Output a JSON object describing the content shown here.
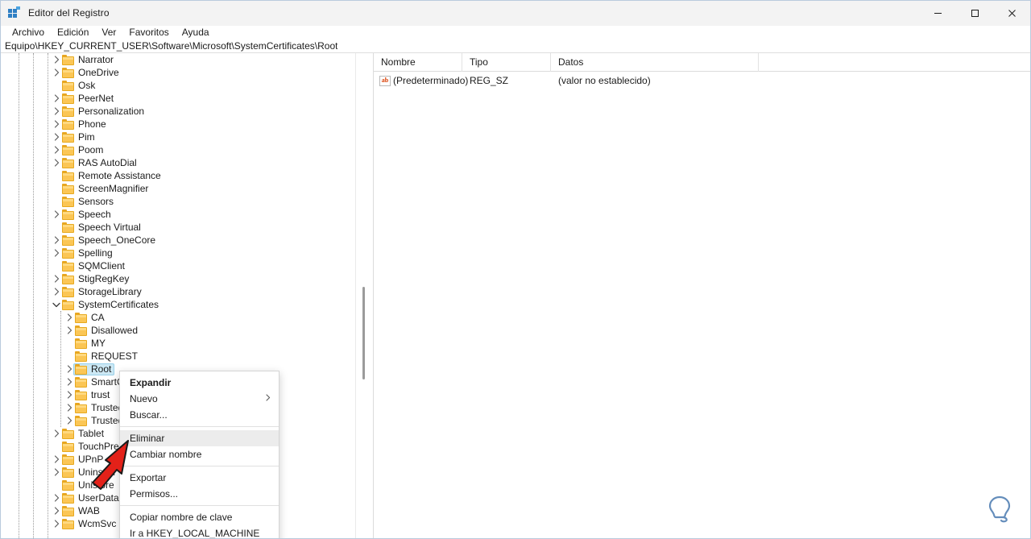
{
  "window": {
    "title": "Editor del Registro",
    "icon": "registry-editor-icon",
    "controls": {
      "minimize": "minimize-icon",
      "maximize": "maximize-icon",
      "close": "close-icon"
    }
  },
  "menubar": {
    "items": [
      {
        "label": "Archivo"
      },
      {
        "label": "Edición"
      },
      {
        "label": "Ver"
      },
      {
        "label": "Favoritos"
      },
      {
        "label": "Ayuda"
      }
    ]
  },
  "addressbar": {
    "path": "Equipo\\HKEY_CURRENT_USER\\Software\\Microsoft\\SystemCertificates\\Root"
  },
  "tree": {
    "nodes": [
      {
        "label": "Narrator",
        "depth": 1,
        "arrow": "collapsed"
      },
      {
        "label": "OneDrive",
        "depth": 1,
        "arrow": "collapsed"
      },
      {
        "label": "Osk",
        "depth": 1,
        "arrow": "none"
      },
      {
        "label": "PeerNet",
        "depth": 1,
        "arrow": "collapsed"
      },
      {
        "label": "Personalization",
        "depth": 1,
        "arrow": "collapsed"
      },
      {
        "label": "Phone",
        "depth": 1,
        "arrow": "collapsed"
      },
      {
        "label": "Pim",
        "depth": 1,
        "arrow": "collapsed"
      },
      {
        "label": "Poom",
        "depth": 1,
        "arrow": "collapsed"
      },
      {
        "label": "RAS AutoDial",
        "depth": 1,
        "arrow": "collapsed"
      },
      {
        "label": "Remote Assistance",
        "depth": 1,
        "arrow": "none"
      },
      {
        "label": "ScreenMagnifier",
        "depth": 1,
        "arrow": "none"
      },
      {
        "label": "Sensors",
        "depth": 1,
        "arrow": "none"
      },
      {
        "label": "Speech",
        "depth": 1,
        "arrow": "collapsed"
      },
      {
        "label": "Speech Virtual",
        "depth": 1,
        "arrow": "none"
      },
      {
        "label": "Speech_OneCore",
        "depth": 1,
        "arrow": "collapsed"
      },
      {
        "label": "Spelling",
        "depth": 1,
        "arrow": "collapsed"
      },
      {
        "label": "SQMClient",
        "depth": 1,
        "arrow": "none"
      },
      {
        "label": "StigRegKey",
        "depth": 1,
        "arrow": "collapsed"
      },
      {
        "label": "StorageLibrary",
        "depth": 1,
        "arrow": "collapsed"
      },
      {
        "label": "SystemCertificates",
        "depth": 1,
        "arrow": "expanded"
      },
      {
        "label": "CA",
        "depth": 2,
        "arrow": "collapsed"
      },
      {
        "label": "Disallowed",
        "depth": 2,
        "arrow": "collapsed"
      },
      {
        "label": "MY",
        "depth": 2,
        "arrow": "none"
      },
      {
        "label": "REQUEST",
        "depth": 2,
        "arrow": "none"
      },
      {
        "label": "Root",
        "depth": 2,
        "arrow": "collapsed",
        "selected": true
      },
      {
        "label": "SmartCardRoot",
        "depth": 2,
        "arrow": "collapsed"
      },
      {
        "label": "trust",
        "depth": 2,
        "arrow": "collapsed"
      },
      {
        "label": "TrustedPeople",
        "depth": 2,
        "arrow": "collapsed"
      },
      {
        "label": "TrustedPublisher",
        "depth": 2,
        "arrow": "collapsed"
      },
      {
        "label": "Tablet",
        "depth": 1,
        "arrow": "collapsed"
      },
      {
        "label": "TouchPrediction",
        "depth": 1,
        "arrow": "none"
      },
      {
        "label": "UPnP",
        "depth": 1,
        "arrow": "collapsed"
      },
      {
        "label": "Uninstall",
        "depth": 1,
        "arrow": "collapsed"
      },
      {
        "label": "Unistore",
        "depth": 1,
        "arrow": "none"
      },
      {
        "label": "UserData",
        "depth": 1,
        "arrow": "collapsed"
      },
      {
        "label": "WAB",
        "depth": 1,
        "arrow": "collapsed"
      },
      {
        "label": "WcmSvc",
        "depth": 1,
        "arrow": "collapsed"
      }
    ]
  },
  "listview": {
    "columns": [
      "Nombre",
      "Tipo",
      "Datos"
    ],
    "rows": [
      {
        "icon": "string-value-icon",
        "name": "(Predeterminado)",
        "type": "REG_SZ",
        "data": "(valor no establecido)"
      }
    ]
  },
  "contextmenu": {
    "items": [
      {
        "label": "Expandir",
        "bold": true
      },
      {
        "label": "Nuevo",
        "submenu": true
      },
      {
        "label": "Buscar..."
      },
      {
        "separator": true
      },
      {
        "label": "Eliminar",
        "highlighted": true
      },
      {
        "label": "Cambiar nombre"
      },
      {
        "separator": true
      },
      {
        "label": "Exportar"
      },
      {
        "label": "Permisos..."
      },
      {
        "separator": true
      },
      {
        "label": "Copiar nombre de clave"
      },
      {
        "label": "Ir a HKEY_LOCAL_MACHINE"
      }
    ]
  },
  "annotation": {
    "cursor": "red-arrow-pointer"
  },
  "watermark": {
    "icon": "lightbulb-watermark-icon"
  },
  "colors": {
    "selection": "#cce8f4",
    "folder": "#fbc655",
    "accent": "#2f7fc4",
    "arrow": "#e02020",
    "menu_highlight": "#ececec"
  }
}
